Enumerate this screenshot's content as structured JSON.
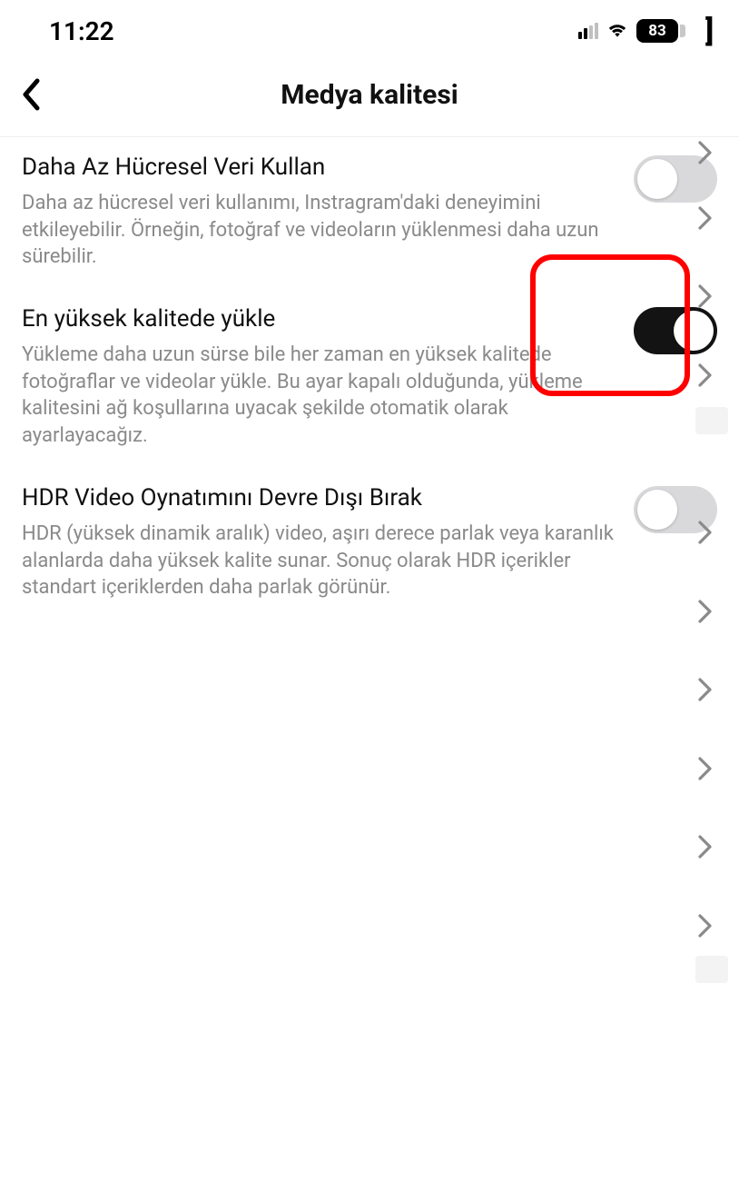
{
  "statusbar": {
    "time": "11:22",
    "battery_percent": "83"
  },
  "navbar": {
    "title": "Medya kalitesi"
  },
  "settings": {
    "items": [
      {
        "title": "Daha Az Hücresel Veri Kullan",
        "description": "Daha az hücresel veri kullanımı, Instragram'daki deneyimini etkileyebilir. Örneğin, fotoğraf ve videoların yüklenmesi daha uzun sürebilir.",
        "on": false
      },
      {
        "title": "En yüksek kalitede yükle",
        "description": "Yükleme daha uzun sürse bile her zaman en yüksek kalitede fotoğraflar ve videolar yükle. Bu ayar kapalı olduğunda, yükleme kalitesini ağ koşullarına uyacak şekilde otomatik olarak ayarlayacağız.",
        "on": true
      },
      {
        "title": "HDR Video Oynatımını Devre Dışı Bırak",
        "description": "HDR (yüksek dinamik aralık) video, aşırı derece parlak veya karanlık alanlarda daha yüksek kalite sunar. Sonuç olarak HDR içerikler standart içeriklerden daha parlak görünür.",
        "on": false
      }
    ]
  }
}
